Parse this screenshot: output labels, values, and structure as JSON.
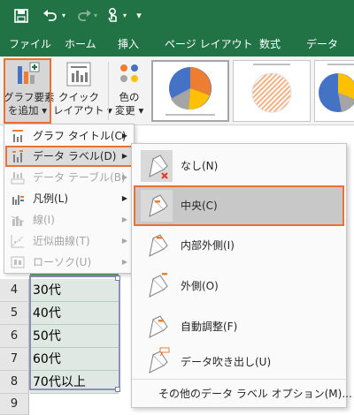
{
  "colors": {
    "accent_green": "#217346",
    "highlight_orange": "#e97132",
    "chart_blue": "#4472c4",
    "chart_orange": "#ed7d31",
    "chart_gray": "#a5a5a5",
    "chart_yellow": "#ffc000"
  },
  "quick_access": {
    "save": "save-icon",
    "undo": "undo-icon",
    "redo": "redo-icon",
    "touch": "touch-mode-icon",
    "customize": "customize-arrow-icon"
  },
  "tabs": [
    "ファイル",
    "ホーム",
    "挿入",
    "ページ レイアウト",
    "数式",
    "データ"
  ],
  "ribbon": {
    "add_element": {
      "line1": "グラフ要素",
      "line2": "を追加",
      "dropdown": "▾"
    },
    "quick_layout": {
      "line1": "クイック",
      "line2": "レイアウト",
      "dropdown": "▾"
    },
    "change_colors": {
      "line1": "色の",
      "line2": "変更",
      "dropdown": "▾"
    }
  },
  "menu": {
    "items": [
      {
        "label": "グラフ タイトル(C)",
        "enabled": true,
        "submenu": true
      },
      {
        "label": "データ ラベル(D)",
        "enabled": true,
        "submenu": true,
        "highlighted": true
      },
      {
        "label": "データ テーブル(B)",
        "enabled": false,
        "submenu": true
      },
      {
        "label": "凡例(L)",
        "enabled": true,
        "submenu": true
      },
      {
        "label": "線(I)",
        "enabled": false,
        "submenu": true
      },
      {
        "label": "近似曲線(T)",
        "enabled": false,
        "submenu": true
      },
      {
        "label": "ローソク(U)",
        "enabled": false,
        "submenu": true
      }
    ]
  },
  "submenu": {
    "items": [
      {
        "label": "なし(N)",
        "icon": "label-none-icon"
      },
      {
        "label": "中央(C)",
        "icon": "label-center-icon",
        "highlighted": true
      },
      {
        "label": "内部外側(I)",
        "icon": "label-inside-end-icon"
      },
      {
        "label": "外側(O)",
        "icon": "label-outside-end-icon"
      },
      {
        "label": "自動調整(F)",
        "icon": "label-best-fit-icon"
      },
      {
        "label": "データ吹き出し(U)",
        "icon": "label-callout-icon"
      }
    ],
    "more_options": "その他のデータ ラベル オプション(M)..."
  },
  "sheet": {
    "rows": [
      {
        "num": "4",
        "value": "30代"
      },
      {
        "num": "5",
        "value": "40代"
      },
      {
        "num": "6",
        "value": "50代"
      },
      {
        "num": "7",
        "value": "60代"
      },
      {
        "num": "8",
        "value": "70代以上"
      },
      {
        "num": "9",
        "value": ""
      }
    ]
  }
}
